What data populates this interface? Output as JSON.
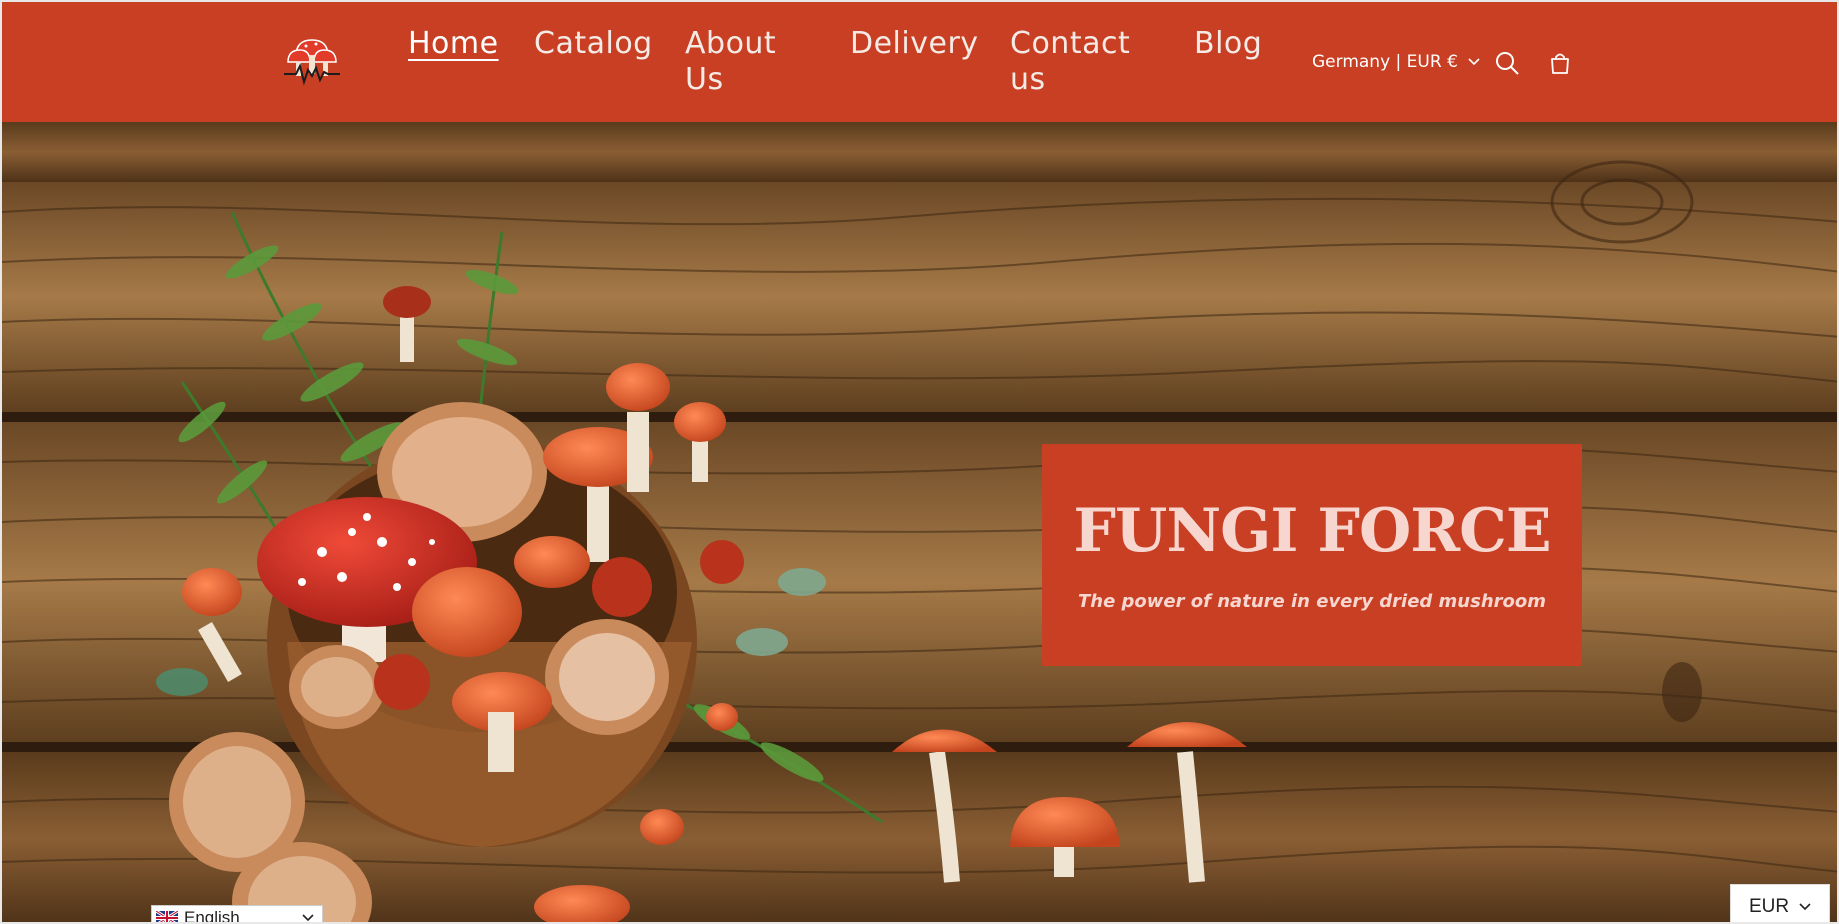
{
  "nav": {
    "logo_icon": "mushroom-heartbeat-logo",
    "items": [
      {
        "label": "Home",
        "active": true
      },
      {
        "label": "Catalog"
      },
      {
        "label": "About Us"
      },
      {
        "label": "Delivery"
      },
      {
        "label": "Contact us"
      },
      {
        "label": "Blog"
      }
    ],
    "region": "Germany | EUR €",
    "search_icon": "search-icon",
    "cart_icon": "cart-icon"
  },
  "hero": {
    "title": "FUNGI FORCE",
    "subtitle": "The power of nature in every dried mushroom"
  },
  "language": {
    "selected": "English",
    "flag_icon": "uk-flag-icon"
  },
  "currency": {
    "selected": "EUR"
  },
  "colors": {
    "brand": "#c83f23",
    "title_text": "#f7d6cf",
    "wood": "#8a5e34"
  }
}
